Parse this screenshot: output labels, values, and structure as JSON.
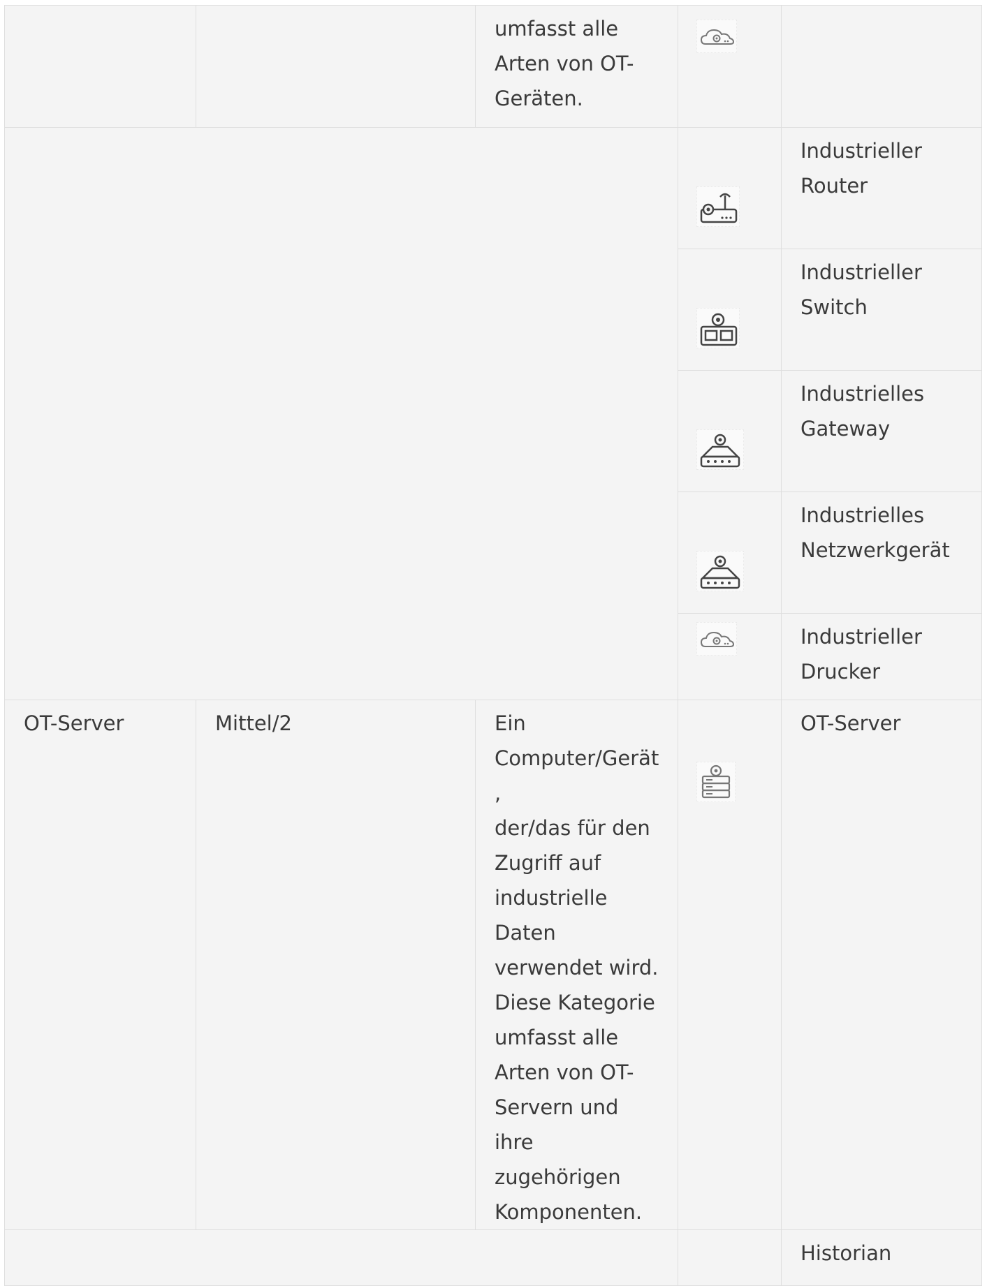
{
  "rows": [
    {
      "col1": "",
      "col2": "",
      "col3": "umfasst alle\nArten von OT-\nGeräten.",
      "icon": "cloud-gear-icon",
      "label": ""
    },
    {
      "icon": "industrial-router-icon",
      "label": "Industrieller\nRouter"
    },
    {
      "icon": "industrial-switch-icon",
      "label": "Industrieller\nSwitch"
    },
    {
      "icon": "industrial-gateway-icon",
      "label": "Industrielles\nGateway"
    },
    {
      "icon": "industrial-network-device-icon",
      "label": "Industrielles\nNetzwerkgerät"
    },
    {
      "icon": "industrial-printer-icon",
      "label": "Industrieller\nDrucker"
    },
    {
      "col1": "OT-Server",
      "col2": "Mittel/2",
      "col3": "Ein\nComputer/Gerät,\nder/das für den\nZugriff auf\nindustrielle\nDaten\nverwendet wird.\nDiese Kategorie\numfasst alle\nArten von OT-\nServern und ihre\nzugehörigen\nKomponenten.",
      "icon": "ot-server-icon",
      "label": "OT-Server"
    },
    {
      "icon": "",
      "label": "Historian"
    }
  ]
}
